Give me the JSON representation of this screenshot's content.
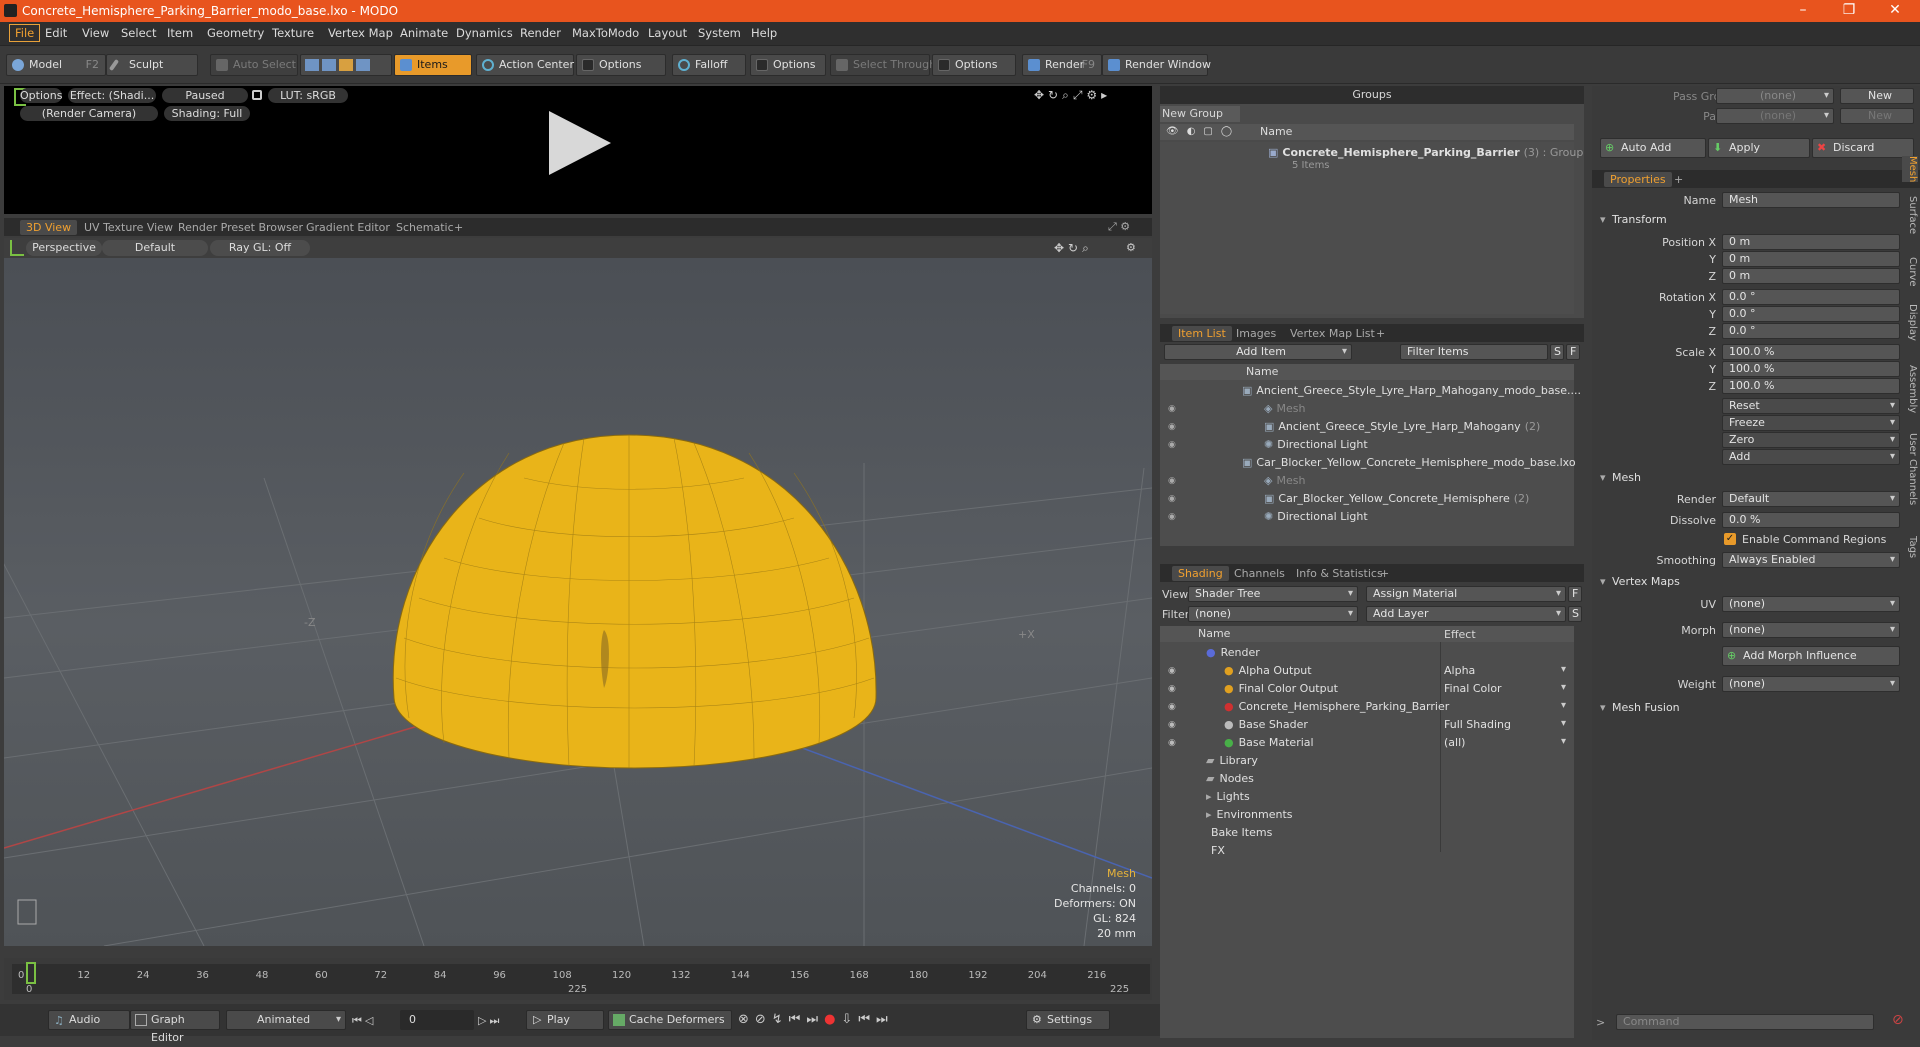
{
  "title": "Concrete_Hemisphere_Parking_Barrier_modo_base.lxo - MODO",
  "window_controls": [
    "–",
    "❐",
    "✕"
  ],
  "menu": [
    "File",
    "Edit",
    "View",
    "Select",
    "Item",
    "Geometry",
    "Texture",
    "Vertex Map",
    "Animate",
    "Dynamics",
    "Render",
    "MaxToModo",
    "Layout",
    "System",
    "Help"
  ],
  "toolbar": {
    "model": "Model",
    "model_key": "F2",
    "sculpt": "Sculpt",
    "auto_select": "Auto Select",
    "items": "Items",
    "action_center": "Action Center",
    "options1": "Options",
    "falloff": "Falloff",
    "options2": "Options",
    "select_through": "Select Through",
    "options3": "Options",
    "render": "Render",
    "render_key": "F9",
    "render_window": "Render Window"
  },
  "preview": {
    "options": "Options",
    "effect": "Effect: (Shadi...",
    "paused": "Paused",
    "lut": "LUT: sRGB",
    "camera": "(Render Camera)",
    "shading": "Shading: Full"
  },
  "viewport_tabs": [
    "3D View",
    "UV Texture View",
    "Render Preset Browser",
    "Gradient Editor",
    "Schematic",
    "+"
  ],
  "viewport": {
    "perspective": "Perspective",
    "default": "Default",
    "raygl": "Ray GL: Off",
    "axis_z": "-Z",
    "axis_x": "+X"
  },
  "stats": {
    "title": "Mesh",
    "channels": "Channels: 0",
    "deformers": "Deformers: ON",
    "gl": "GL: 824",
    "size": "20 mm"
  },
  "timeline": {
    "ticks": [
      "0",
      "12",
      "24",
      "36",
      "48",
      "60",
      "72",
      "84",
      "96",
      "108",
      "120",
      "132",
      "144",
      "156",
      "168",
      "180",
      "192",
      "204",
      "216"
    ],
    "start": "0",
    "mid": "225",
    "end": "225"
  },
  "bottom": {
    "audio": "Audio",
    "graph_editor": "Graph Editor",
    "animated": "Animated",
    "frame": "0",
    "play": "Play",
    "cache": "Cache Deformers",
    "settings": "Settings"
  },
  "groups": {
    "title": "Groups",
    "new_group": "New Group",
    "col_name": "Name",
    "item": "Concrete_Hemisphere_Parking_Barrier",
    "item_count": "(3) : Group",
    "item_sub": "5 Items"
  },
  "item_list": {
    "tabs": [
      "Item List",
      "Images",
      "Vertex Map List",
      "+"
    ],
    "add_item": "Add Item",
    "filter": "Filter Items",
    "s": "S",
    "f": "F",
    "col_name": "Name",
    "rows": [
      {
        "label": "Ancient_Greece_Style_Lyre_Harp_Mahogany_modo_base....",
        "indent": 0,
        "sub": ""
      },
      {
        "label": "Mesh",
        "indent": 1,
        "sub": ""
      },
      {
        "label": "Ancient_Greece_Style_Lyre_Harp_Mahogany",
        "indent": 1,
        "sub": "(2)"
      },
      {
        "label": "Directional Light",
        "indent": 1,
        "sub": ""
      },
      {
        "label": "Car_Blocker_Yellow_Concrete_Hemisphere_modo_base.lxo",
        "indent": 0,
        "sub": ""
      },
      {
        "label": "Mesh",
        "indent": 1,
        "sub": ""
      },
      {
        "label": "Car_Blocker_Yellow_Concrete_Hemisphere",
        "indent": 1,
        "sub": "(2)"
      },
      {
        "label": "Directional Light",
        "indent": 1,
        "sub": ""
      }
    ]
  },
  "shading": {
    "tabs": [
      "Shading",
      "Channels",
      "Info & Statistics",
      "+"
    ],
    "view_label": "View",
    "view": "Shader Tree",
    "assign": "Assign Material",
    "f": "F",
    "filter_label": "Filter",
    "filter": "(none)",
    "add_layer": "Add Layer",
    "s": "S",
    "col_name": "Name",
    "col_effect": "Effect",
    "rows": [
      {
        "label": "Render",
        "effect": ""
      },
      {
        "label": "Alpha Output",
        "effect": "Alpha"
      },
      {
        "label": "Final Color Output",
        "effect": "Final Color"
      },
      {
        "label": "Concrete_Hemisphere_Parking_Barrier",
        "effect": ""
      },
      {
        "label": "Base Shader",
        "effect": "Full Shading"
      },
      {
        "label": "Base Material",
        "effect": "(all)"
      },
      {
        "label": "Library",
        "effect": ""
      },
      {
        "label": "Nodes",
        "effect": ""
      },
      {
        "label": "Lights",
        "effect": ""
      },
      {
        "label": "Environments",
        "effect": ""
      },
      {
        "label": "Bake Items",
        "effect": ""
      },
      {
        "label": "FX",
        "effect": ""
      }
    ]
  },
  "pass": {
    "pass_groups": "Pass Groups",
    "passes": "Passes",
    "none": "(none)",
    "new": "New",
    "auto_add": "Auto Add",
    "apply": "Apply",
    "discard": "Discard"
  },
  "properties": {
    "tab": "Properties",
    "name_label": "Name",
    "name": "Mesh",
    "transform": "Transform",
    "position_x": "Position X",
    "y": "Y",
    "z": "Z",
    "pos": [
      "0 m",
      "0 m",
      "0 m"
    ],
    "rotation_x": "Rotation X",
    "rot": [
      "0.0 °",
      "0.0 °",
      "0.0 °"
    ],
    "scale_x": "Scale X",
    "scale": [
      "100.0 %",
      "100.0 %",
      "100.0 %"
    ],
    "reset": "Reset",
    "freeze": "Freeze",
    "zero": "Zero",
    "add": "Add",
    "mesh": "Mesh",
    "render_label": "Render",
    "render": "Default",
    "dissolve_label": "Dissolve",
    "dissolve": "0.0 %",
    "enable_cmd": "Enable Command Regions",
    "smoothing_label": "Smoothing",
    "smoothing": "Always Enabled",
    "vertex_maps": "Vertex Maps",
    "uv_label": "UV",
    "uv": "(none)",
    "morph_label": "Morph",
    "morph": "(none)",
    "add_morph": "Add Morph Influence",
    "weight_label": "Weight",
    "weight": "(none)",
    "mesh_fusion": "Mesh Fusion",
    "side_tabs": [
      "Mesh",
      "Surface",
      "Curve",
      "Display",
      "Assembly",
      "User Channels",
      "Tags"
    ]
  },
  "command": {
    "placeholder": "Command"
  }
}
